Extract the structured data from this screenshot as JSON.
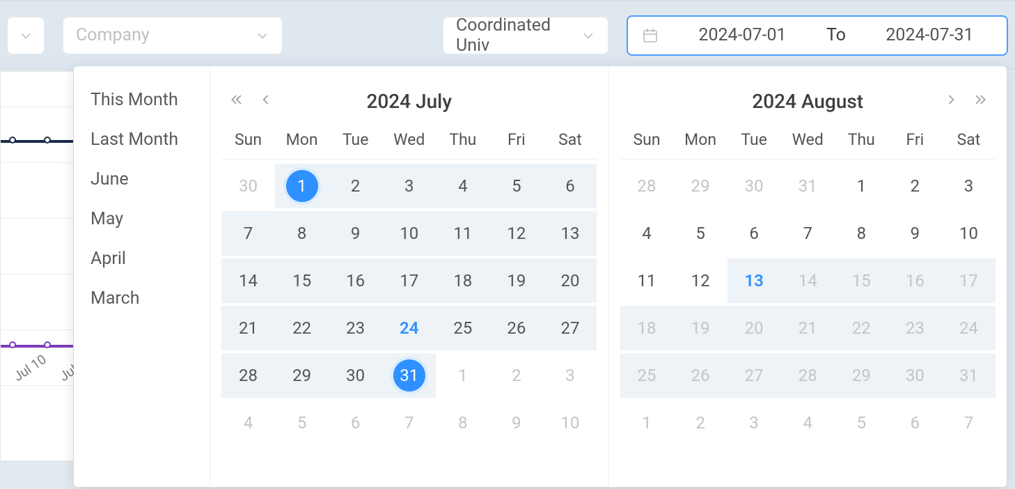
{
  "topbar": {
    "company_placeholder": "Company",
    "timezone_value": "Coordinated Univ",
    "date_from": "2024-07-01",
    "date_to_label": "To",
    "date_to": "2024-07-31"
  },
  "shortcuts": [
    "This Month",
    "Last Month",
    "June",
    "May",
    "April",
    "March"
  ],
  "weekdays": [
    "Sun",
    "Mon",
    "Tue",
    "Wed",
    "Thu",
    "Fri",
    "Sat"
  ],
  "months": {
    "left": {
      "title": "2024 July",
      "days": [
        {
          "n": 30,
          "other": true
        },
        {
          "n": 1,
          "selected": true,
          "in_range": true
        },
        {
          "n": 2,
          "in_range": true
        },
        {
          "n": 3,
          "in_range": true
        },
        {
          "n": 4,
          "in_range": true
        },
        {
          "n": 5,
          "in_range": true
        },
        {
          "n": 6,
          "in_range": true
        },
        {
          "n": 7,
          "in_range": true
        },
        {
          "n": 8,
          "in_range": true
        },
        {
          "n": 9,
          "in_range": true
        },
        {
          "n": 10,
          "in_range": true
        },
        {
          "n": 11,
          "in_range": true
        },
        {
          "n": 12,
          "in_range": true
        },
        {
          "n": 13,
          "in_range": true
        },
        {
          "n": 14,
          "in_range": true
        },
        {
          "n": 15,
          "in_range": true
        },
        {
          "n": 16,
          "in_range": true
        },
        {
          "n": 17,
          "in_range": true
        },
        {
          "n": 18,
          "in_range": true
        },
        {
          "n": 19,
          "in_range": true
        },
        {
          "n": 20,
          "in_range": true
        },
        {
          "n": 21,
          "in_range": true
        },
        {
          "n": 22,
          "in_range": true
        },
        {
          "n": 23,
          "in_range": true
        },
        {
          "n": 24,
          "in_range": true,
          "today": true
        },
        {
          "n": 25,
          "in_range": true
        },
        {
          "n": 26,
          "in_range": true
        },
        {
          "n": 27,
          "in_range": true
        },
        {
          "n": 28,
          "in_range": true
        },
        {
          "n": 29,
          "in_range": true
        },
        {
          "n": 30,
          "in_range": true
        },
        {
          "n": 31,
          "selected": true,
          "in_range": true
        },
        {
          "n": 1,
          "other": true
        },
        {
          "n": 2,
          "other": true
        },
        {
          "n": 3,
          "other": true
        },
        {
          "n": 4,
          "other": true
        },
        {
          "n": 5,
          "other": true
        },
        {
          "n": 6,
          "other": true
        },
        {
          "n": 7,
          "other": true
        },
        {
          "n": 8,
          "other": true
        },
        {
          "n": 9,
          "other": true
        },
        {
          "n": 10,
          "other": true
        }
      ]
    },
    "right": {
      "title": "2024 August",
      "days": [
        {
          "n": 28,
          "other": true
        },
        {
          "n": 29,
          "other": true
        },
        {
          "n": 30,
          "other": true
        },
        {
          "n": 31,
          "other": true
        },
        {
          "n": 1
        },
        {
          "n": 2
        },
        {
          "n": 3
        },
        {
          "n": 4
        },
        {
          "n": 5
        },
        {
          "n": 6
        },
        {
          "n": 7
        },
        {
          "n": 8
        },
        {
          "n": 9
        },
        {
          "n": 10
        },
        {
          "n": 11
        },
        {
          "n": 12
        },
        {
          "n": 13,
          "today": true,
          "today_bg": true
        },
        {
          "n": 14,
          "other": true,
          "in_range": true
        },
        {
          "n": 15,
          "other": true,
          "in_range": true
        },
        {
          "n": 16,
          "other": true,
          "in_range": true
        },
        {
          "n": 17,
          "other": true,
          "in_range": true
        },
        {
          "n": 18,
          "other": true,
          "in_range": true
        },
        {
          "n": 19,
          "other": true,
          "in_range": true
        },
        {
          "n": 20,
          "other": true,
          "in_range": true
        },
        {
          "n": 21,
          "other": true,
          "in_range": true
        },
        {
          "n": 22,
          "other": true,
          "in_range": true
        },
        {
          "n": 23,
          "other": true,
          "in_range": true
        },
        {
          "n": 24,
          "other": true,
          "in_range": true
        },
        {
          "n": 25,
          "other": true,
          "in_range": true
        },
        {
          "n": 26,
          "other": true,
          "in_range": true
        },
        {
          "n": 27,
          "other": true,
          "in_range": true
        },
        {
          "n": 28,
          "other": true,
          "in_range": true
        },
        {
          "n": 29,
          "other": true,
          "in_range": true
        },
        {
          "n": 30,
          "other": true,
          "in_range": true
        },
        {
          "n": 31,
          "other": true,
          "in_range": true
        },
        {
          "n": 1,
          "other": true
        },
        {
          "n": 2,
          "other": true
        },
        {
          "n": 3,
          "other": true
        },
        {
          "n": 4,
          "other": true
        },
        {
          "n": 5,
          "other": true
        },
        {
          "n": 6,
          "other": true
        },
        {
          "n": 7,
          "other": true
        }
      ]
    }
  },
  "chart_peek": {
    "x_labels": [
      "Jul 10",
      "Jul"
    ]
  }
}
